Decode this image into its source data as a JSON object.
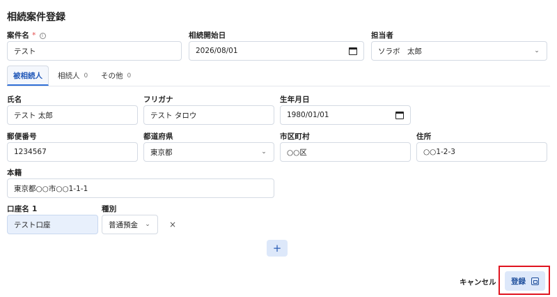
{
  "page": {
    "title": "相続案件登録"
  },
  "case": {
    "name_label": "案件名",
    "required_mark": "*",
    "info_icon": "i",
    "name_value": "テスト",
    "start_date_label": "相続開始日",
    "start_date_value": "2026/08/01",
    "assignee_label": "担当者",
    "assignee_value": "ソラボ　太郎"
  },
  "tabs": [
    {
      "label": "被相続人",
      "count": ""
    },
    {
      "label": "相続人",
      "count": "0"
    },
    {
      "label": "その他",
      "count": "0"
    }
  ],
  "decedent": {
    "name_label": "氏名",
    "name_value": "テスト 太郎",
    "kana_label": "フリガナ",
    "kana_value": "テスト タロウ",
    "birth_label": "生年月日",
    "birth_value": "1980/01/01",
    "zip_label": "郵便番号",
    "zip_value": "1234567",
    "pref_label": "都道府県",
    "pref_value": "東京都",
    "city_label": "市区町村",
    "city_value": "○○区",
    "address_label": "住所",
    "address_value": "○○1-2-3",
    "domicile_label": "本籍",
    "domicile_value": "東京都○○市○○1-1-1"
  },
  "account": {
    "name_label": "口座名 1",
    "name_value": "テスト口座",
    "type_label": "種別",
    "type_value": "普通預金",
    "remove_glyph": "×",
    "add_glyph": "+"
  },
  "footer": {
    "cancel_label": "キャンセル",
    "save_label": "登録"
  },
  "colors": {
    "accent": "#2f6fd6",
    "highlight": "#e0141f",
    "button_bg": "#dde8fa"
  }
}
